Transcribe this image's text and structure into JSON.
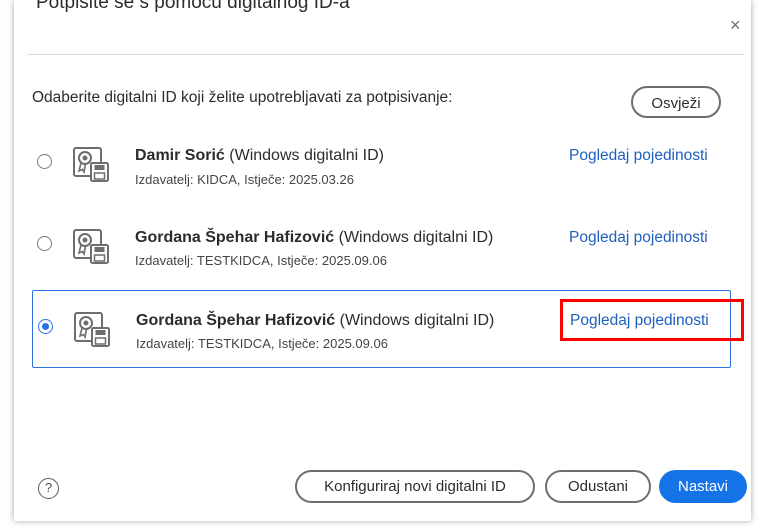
{
  "dialog": {
    "title": "Potpišite se s pomoću digitalnog ID-a",
    "close_glyph": "×",
    "prompt": "Odaberite digitalni ID koji želite upotrebljavati za potpisivanje:",
    "refresh_label": "Osvježi"
  },
  "ids": [
    {
      "name": "Damir Sorić",
      "type": " (Windows digitalni ID)",
      "meta": "Izdavatelj: KIDCA, Istječe: 2025.03.26",
      "details_label": "Pogledaj pojedinosti",
      "selected": false
    },
    {
      "name": "Gordana Špehar Hafizović",
      "type": " (Windows digitalni ID)",
      "meta": "Izdavatelj: TESTKIDCA, Istječe: 2025.09.06",
      "details_label": "Pogledaj pojedinosti",
      "selected": false
    },
    {
      "name": "Gordana Špehar Hafizović",
      "type": " (Windows digitalni ID)",
      "meta": "Izdavatelj: TESTKIDCA, Istječe: 2025.09.06",
      "details_label": "Pogledaj pojedinosti",
      "selected": true
    }
  ],
  "footer": {
    "help_glyph": "?",
    "configure_label": "Konfiguriraj novi digitalni ID",
    "cancel_label": "Odustani",
    "continue_label": "Nastavi"
  },
  "colors": {
    "accent": "#1473e6",
    "link": "#1f5fbf",
    "selection_border": "#2b73e0",
    "highlight": "#ff0000"
  },
  "icons": {
    "id_icon": "certificate-icon",
    "help_icon": "help-icon",
    "close_icon": "close-icon"
  }
}
